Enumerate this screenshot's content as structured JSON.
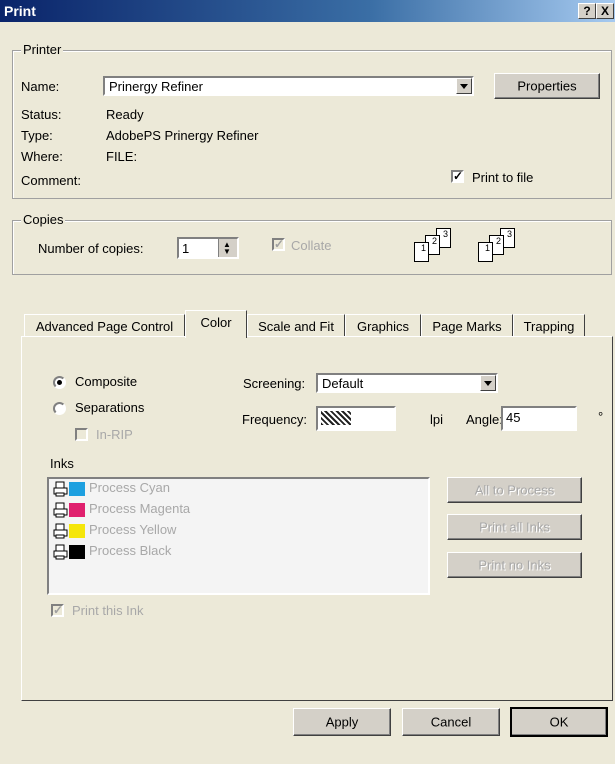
{
  "window": {
    "title": "Print",
    "help_btn": "?",
    "close_btn": "X"
  },
  "printer": {
    "legend": "Printer",
    "name_label": "Name:",
    "name_value": "Prinergy Refiner",
    "properties_btn": "Properties",
    "status_label": "Status:",
    "status_value": "Ready",
    "type_label": "Type:",
    "type_value": "AdobePS Prinergy Refiner",
    "where_label": "Where:",
    "where_value": "FILE:",
    "comment_label": "Comment:",
    "print_to_file_label": "Print to file",
    "print_to_file_checked": true
  },
  "copies": {
    "legend": "Copies",
    "number_label": "Number of copies:",
    "number_value": "1",
    "collate_label": "Collate",
    "collate_checked": true,
    "collate_enabled": false
  },
  "tabs": [
    {
      "label": "Advanced Page Control",
      "active": false
    },
    {
      "label": "Color",
      "active": true
    },
    {
      "label": "Scale and Fit",
      "active": false
    },
    {
      "label": "Graphics",
      "active": false
    },
    {
      "label": "Page Marks",
      "active": false
    },
    {
      "label": "Trapping",
      "active": false
    }
  ],
  "color": {
    "composite_label": "Composite",
    "separations_label": "Separations",
    "mode_selected": "Composite",
    "inrip_label": "In-RIP",
    "screening_label": "Screening:",
    "screening_value": "Default",
    "frequency_label": "Frequency:",
    "frequency_unit": "lpi",
    "angle_label": "Angle:",
    "angle_value": "45",
    "angle_unit": "°",
    "inks_label": "Inks",
    "inks": [
      {
        "name": "Process Cyan",
        "color": "#1ea0e0"
      },
      {
        "name": "Process Magenta",
        "color": "#e0206e"
      },
      {
        "name": "Process Yellow",
        "color": "#f5e60a"
      },
      {
        "name": "Process Black",
        "color": "#000000"
      }
    ],
    "all_to_process_btn": "All to Process",
    "print_all_inks_btn": "Print all Inks",
    "print_no_inks_btn": "Print no Inks",
    "print_this_ink_label": "Print this Ink",
    "print_this_ink_checked": true
  },
  "footer": {
    "apply_btn": "Apply",
    "cancel_btn": "Cancel",
    "ok_btn": "OK"
  }
}
